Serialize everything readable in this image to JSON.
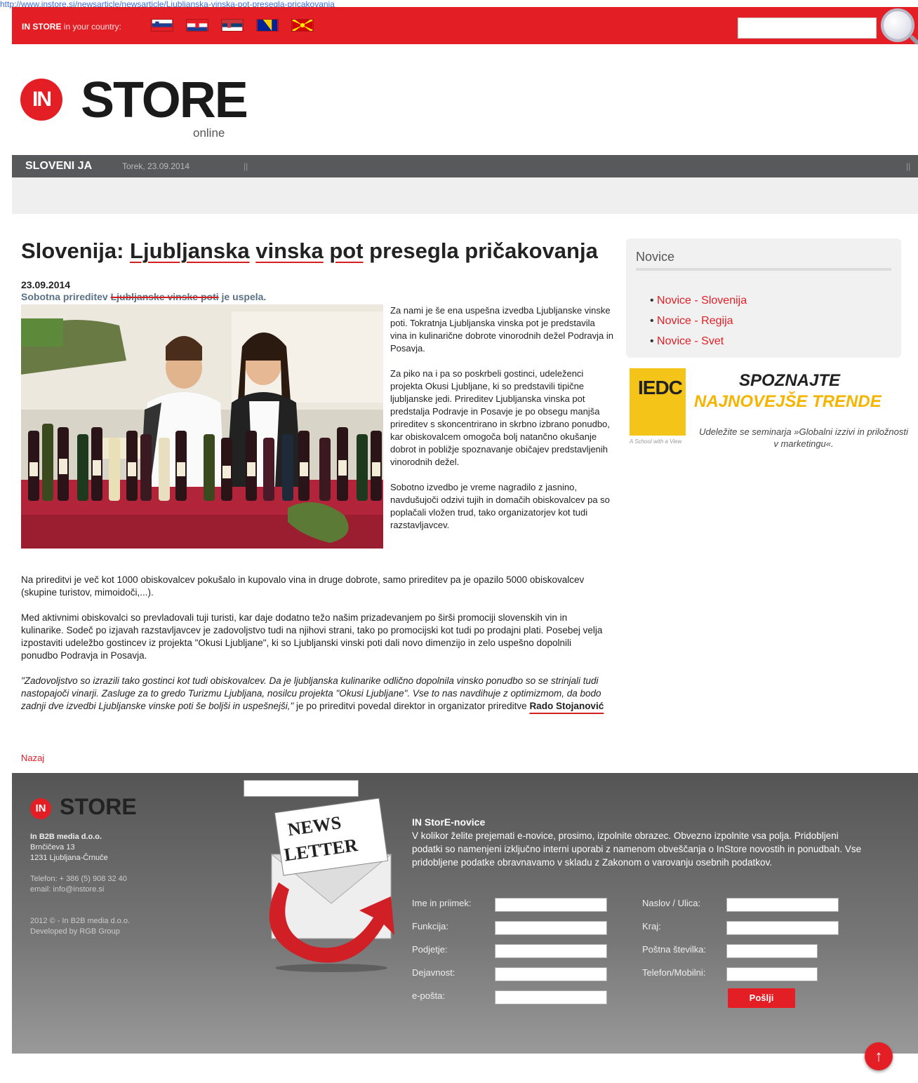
{
  "url": "http://www.instore.si/newsarticle/newsarticle/Ljubljanska-vinska-pot-presegla-pricakovanja",
  "topbar": {
    "country_label_bold": "IN STORE",
    "country_label_rest": " in your country:",
    "flags": [
      "slovenia-flag-icon",
      "croatia-flag-icon",
      "serbia-flag-icon",
      "bosnia-flag-icon",
      "macedonia-flag-icon"
    ],
    "search_placeholder": ""
  },
  "logo": {
    "in": "IN",
    "store": "STORE",
    "online": "online"
  },
  "nav": {
    "region": "SLOVENI JA",
    "date": "Torek, 23.09.2014",
    "sep": "||"
  },
  "article": {
    "title_pre": "Slovenija: ",
    "title_u1": "Ljubljanska",
    "title_u2": "vinska",
    "title_u3": "pot",
    "title_post": " presegla pričakovanja",
    "date": "23.09.2014",
    "lead_pre": "Sobotna prireditev ",
    "lead_strike": "Ljubljanske vinske poti",
    "lead_post": " je uspela.",
    "side_p1": "Za nami je še ena uspešna izvedba Ljubljanske vinske poti. Tokratnja Ljubljanska vinska pot je predstavila vina in kulinarične dobrote vinorodnih dežel Podravja in Posavja.",
    "side_p2": "Za piko na i pa so poskrbeli gostinci, udeleženci projekta Okusi Ljubljane, ki so predstavili tipične ljubljanske jedi. Prireditev Ljubljanska vinska pot predstalja Podravje in Posavje je po obsegu manjša prireditev s skoncentrirano in skrbno izbrano ponudbo, kar obiskovalcem omogoča bolj natančno okušanje dobrot in pobližje spoznavanje običajev predstavljenih vinorodnih dežel.",
    "side_p3": "Sobotno izvedbo je vreme nagradilo z jasnino, navdušujoči odzivi tujih in domačih obiskovalcev pa so poplačali vložen trud, tako organizatorjev kot tudi razstavljavcev.",
    "p4": "Na prireditvi je več kot 1000 obiskovalcev pokušalo in kupovalo vina in druge dobrote, samo prireditev pa je opazilo 5000 obiskovalcev (skupine turistov, mimoidoči,...).",
    "p5": "Med aktivnimi obiskovalci so prevladovali tuji turisti, kar daje dodatno težo našim prizadevanjem po širši promociji slovenskih vin in kulinarike. Sodeč po izjavah razstavljavcev je zadovoljstvo tudi na njihovi strani, tako po promocijski kot tudi po prodajni plati. Posebej velja izpostaviti udeležbo gostincev iz projekta \"Okusi Ljubljane\", ki so Ljubljanski vinski poti dali novo dimenzijo in zelo uspešno dopolnili ponudbo Podravja in Posavja.",
    "p6_italic": "\"Zadovoljstvo so izrazili tako gostinci kot tudi obiskovalcev. Da je ljubljanska kulinarike odlično dopolnila vinsko ponudbo so se strinjali tudi nastopajoči vinarji. Zasluge za to gredo Turizmu Ljubljana, nosilcu projekta \"Okusi Ljubljane\". Vse to nas navdihuje z optimizmom, da bodo zadnji dve izvedbi Ljubljanske vinske poti še boljši in uspešnejši,\"",
    "p6_rest": " je po prireditvi povedal direktor in organizator prireditve ",
    "p6_name": "Rado Stojanović",
    "back": "Nazaj"
  },
  "sidebar": {
    "novice_title": "Novice",
    "links": [
      "Novice - Slovenija",
      "Novice - Regija",
      "Novice - Svet"
    ]
  },
  "ad": {
    "logo": "IEDC",
    "small": "A School with a View",
    "line1": "SPOZNAJTE",
    "line2": "NAJNOVEJŠE TRENDE",
    "sub": "Udeležite se seminarja »Globalni izzivi in priložnosti v marketingu«."
  },
  "footer": {
    "logo_in": "IN",
    "logo_store": "STORE",
    "company": "In B2B media d.o.o.",
    "street": "Brnčičeva 13",
    "city": "1231 Ljubljana-Črnuče",
    "phone": "Telefon: + 386 (5) 908 32 40",
    "email": "email: info@instore.si",
    "copyright": "2012 © - In B2B media d.o.o.",
    "developed": "Developed by RGB Group",
    "newsletter_line1": "NEWS",
    "newsletter_line2": "LETTER"
  },
  "form": {
    "title": "IN StorE-novice",
    "desc": "V kolikor želite prejemati e-novice, prosimo, izpolnite obrazec. Obvezno izpolnite vsa polja. Pridobljeni podatki so namenjeni izključno interni uporabi z namenom obveščanja o InStore novostih in ponudbah. Vse pridobljene podatke obravnavamo v skladu z Zakonom o varovanju osebnih podatkov.",
    "left_labels": [
      "Ime in priimek:",
      "Funkcija:",
      "Podjetje:",
      "Dejavnost:",
      "e-pošta:"
    ],
    "right_labels": [
      "Naslov / Ulica:",
      "Kraj:",
      "Poštna številka:",
      "Telefon/Mobilni:"
    ],
    "submit": "Pošlji"
  },
  "colors": {
    "brand_red": "#e41e25",
    "nav_gray": "#58595b",
    "ad_yellow": "#f4c518"
  }
}
